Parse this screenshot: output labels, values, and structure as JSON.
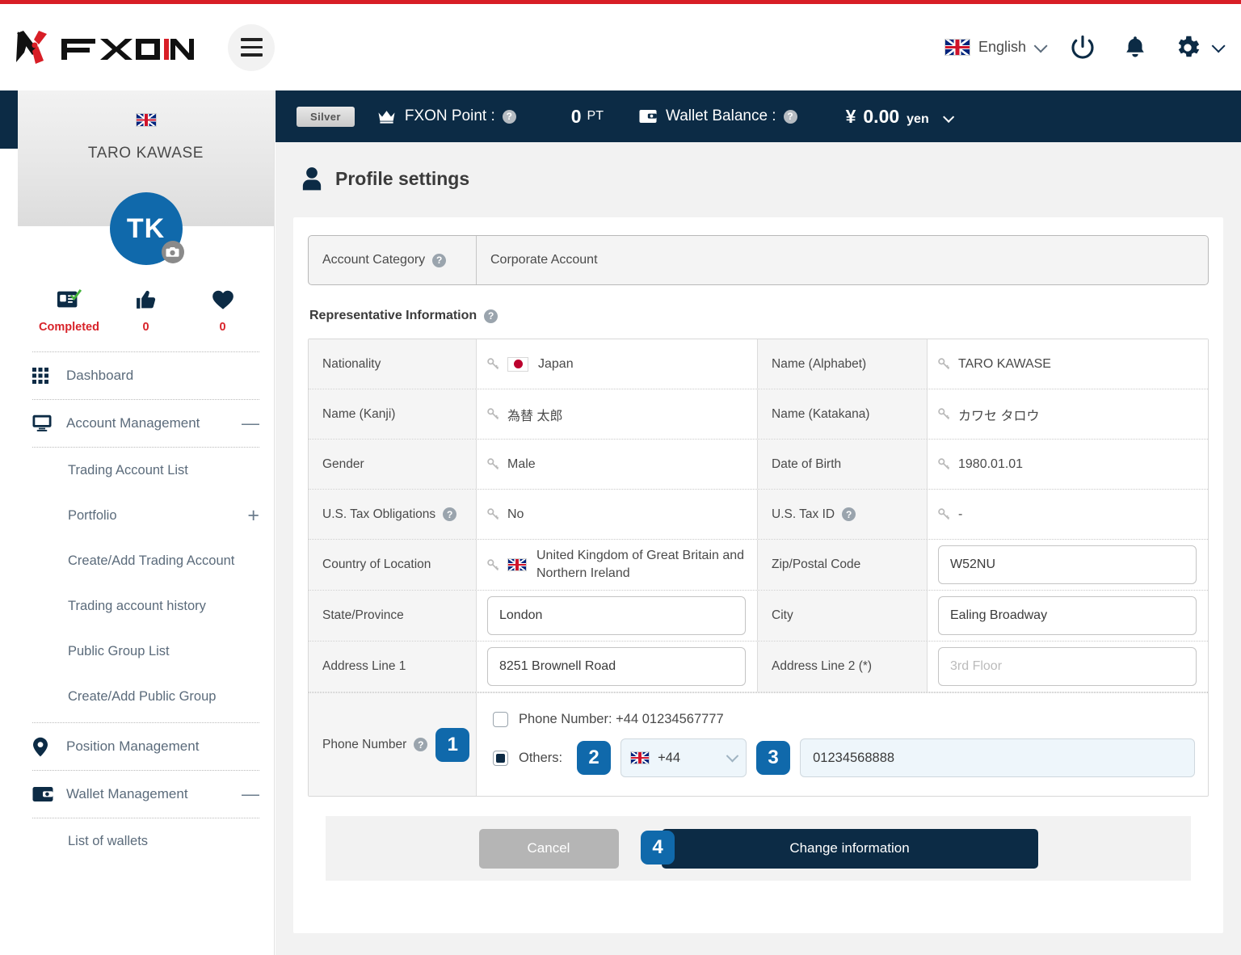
{
  "header": {
    "logo_text": "FXON",
    "menu_icon": "hamburger-icon",
    "language": "English",
    "icons": [
      "power-icon",
      "bell-icon",
      "gear-icon"
    ]
  },
  "sidebar": {
    "user_name": "TARO KAWASE",
    "avatar_initials": "TK",
    "stats": [
      {
        "icon": "id-card-check-icon",
        "label": "Completed"
      },
      {
        "icon": "thumbs-up-icon",
        "label": "0"
      },
      {
        "icon": "heart-icon",
        "label": "0"
      }
    ],
    "items": [
      {
        "label": "Dashboard",
        "icon": "grid-icon",
        "toggle": ""
      },
      {
        "label": "Account Management",
        "icon": "monitor-icon",
        "toggle": "—"
      },
      {
        "label": "Position Management",
        "icon": "map-pin-icon",
        "toggle": ""
      },
      {
        "label": "Wallet Management",
        "icon": "wallet-icon",
        "toggle": "—"
      }
    ],
    "account_sub_items": [
      {
        "label": "Trading Account List",
        "toggle": ""
      },
      {
        "label": "Portfolio",
        "toggle": "+"
      },
      {
        "label": "Create/Add Trading Account",
        "toggle": ""
      },
      {
        "label": "Trading account history",
        "toggle": ""
      },
      {
        "label": "Public Group List",
        "toggle": ""
      },
      {
        "label": "Create/Add Public Group",
        "toggle": ""
      }
    ],
    "wallet_sub_items": [
      {
        "label": "List of wallets",
        "toggle": ""
      }
    ]
  },
  "statusbar": {
    "rank": "Silver",
    "fxon_point_label": "FXON Point :",
    "point_value": "0",
    "point_unit": "PT",
    "wallet_balance_label": "Wallet Balance :",
    "balance_symbol": "¥",
    "balance_value": "0.00",
    "balance_unit": "yen"
  },
  "page": {
    "title": "Profile settings",
    "account_category_label": "Account Category",
    "account_category_value": "Corporate Account",
    "section_title": "Representative Information"
  },
  "form": {
    "rows": [
      {
        "left_label": "Nationality",
        "left_value": "Japan",
        "left_locked": true,
        "left_flag": "jp",
        "right_label": "Name (Alphabet)",
        "right_value": "TARO KAWASE",
        "right_locked": true
      },
      {
        "left_label": "Name (Kanji)",
        "left_value": "為替 太郎",
        "left_locked": true,
        "right_label": "Name (Katakana)",
        "right_value": "カワセ タロウ",
        "right_locked": true
      },
      {
        "left_label": "Gender",
        "left_value": "Male",
        "left_locked": true,
        "right_label": "Date of Birth",
        "right_value": "1980.01.01",
        "right_locked": true
      },
      {
        "left_label": "U.S. Tax Obligations",
        "left_label_help": true,
        "left_value": "No",
        "left_locked": true,
        "right_label": "U.S. Tax ID",
        "right_label_help": true,
        "right_value": "-",
        "right_locked": true
      },
      {
        "left_label": "Country of Location",
        "left_value": "United Kingdom of Great Britain and Northern Ireland",
        "left_locked": true,
        "left_flag": "uk",
        "right_label": "Zip/Postal Code",
        "right_input_value": "W52NU"
      },
      {
        "left_label": "State/Province",
        "left_input_value": "London",
        "right_label": "City",
        "right_input_value": "Ealing Broadway"
      },
      {
        "left_label": "Address Line 1",
        "left_input_value": "8251 Brownell Road",
        "right_label": "Address Line 2 (*)",
        "right_input_placeholder": "3rd Floor"
      }
    ],
    "phone": {
      "label": "Phone Number",
      "option_existing_label": "Phone Number: +44 01234567777",
      "option_existing_checked": false,
      "option_others_label": "Others:",
      "option_others_checked": true,
      "country_code": "+44",
      "country_flag": "uk",
      "number_value": "01234568888"
    }
  },
  "footer": {
    "cancel_label": "Cancel",
    "submit_label": "Change information"
  },
  "badges": [
    {
      "number": "1"
    },
    {
      "number": "2"
    },
    {
      "number": "3"
    },
    {
      "number": "4"
    }
  ],
  "colors": {
    "accent_red": "#d81e26",
    "navy": "#0c2b45",
    "badge_blue": "#1069ab",
    "avatar_blue": "#1069ab",
    "stat_red": "#d8232a"
  }
}
